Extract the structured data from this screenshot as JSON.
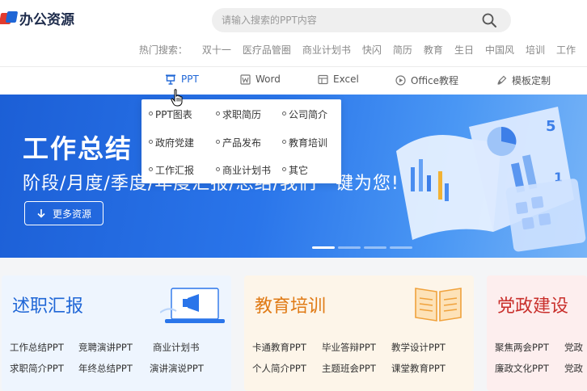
{
  "logo": {
    "text": "办公资源"
  },
  "search": {
    "placeholder": "请输入搜索的PPT内容"
  },
  "hot_search": {
    "label": "热门搜索：",
    "keywords": [
      "双十一",
      "医疗品管圈",
      "商业计划书",
      "快闪",
      "简历",
      "教育",
      "生日",
      "中国风",
      "培训",
      "工作"
    ]
  },
  "nav": {
    "items": [
      {
        "label": "PPT",
        "icon": "presentation-icon"
      },
      {
        "label": "Word",
        "icon": "word-icon"
      },
      {
        "label": "Excel",
        "icon": "excel-icon"
      },
      {
        "label": "Office教程",
        "icon": "play-circle-icon"
      },
      {
        "label": "模板定制",
        "icon": "brush-icon"
      }
    ],
    "active_color": "#1f66d6"
  },
  "dropdown": {
    "items": [
      "PPT图表",
      "求职简历",
      "公司简介",
      "政府党建",
      "产品发布",
      "教育培训",
      "工作汇报",
      "商业计划书",
      "其它"
    ]
  },
  "banner": {
    "title": "工作总结",
    "subtitle": "阶段/月度/季度/年度汇报/总结/我们一键为您!",
    "button": "更多资源",
    "slides": 4,
    "active_slide": 1
  },
  "cards": [
    {
      "title": "述职汇报",
      "title_color": "#1f66d6",
      "bg": "#eaf3fd",
      "links": [
        "工作总结PPT",
        "竞聘演讲PPT",
        "商业计划书",
        "求职简介PPT",
        "年终总结PPT",
        "演讲演说PPT"
      ]
    },
    {
      "title": "教育培训",
      "title_color": "#e07a15",
      "bg": "#fdf4e6",
      "links": [
        "卡通教育PPT",
        "毕业答辩PPT",
        "教学设计PPT",
        "个人简介PPT",
        "主题班会PPT",
        "课堂教育PPT"
      ]
    },
    {
      "title": "党政建设",
      "title_color": "#c9302c",
      "bg": "#fdeeee",
      "links": [
        "聚焦两会PPT",
        "党政",
        "廉政文化PPT",
        "党政"
      ]
    }
  ]
}
